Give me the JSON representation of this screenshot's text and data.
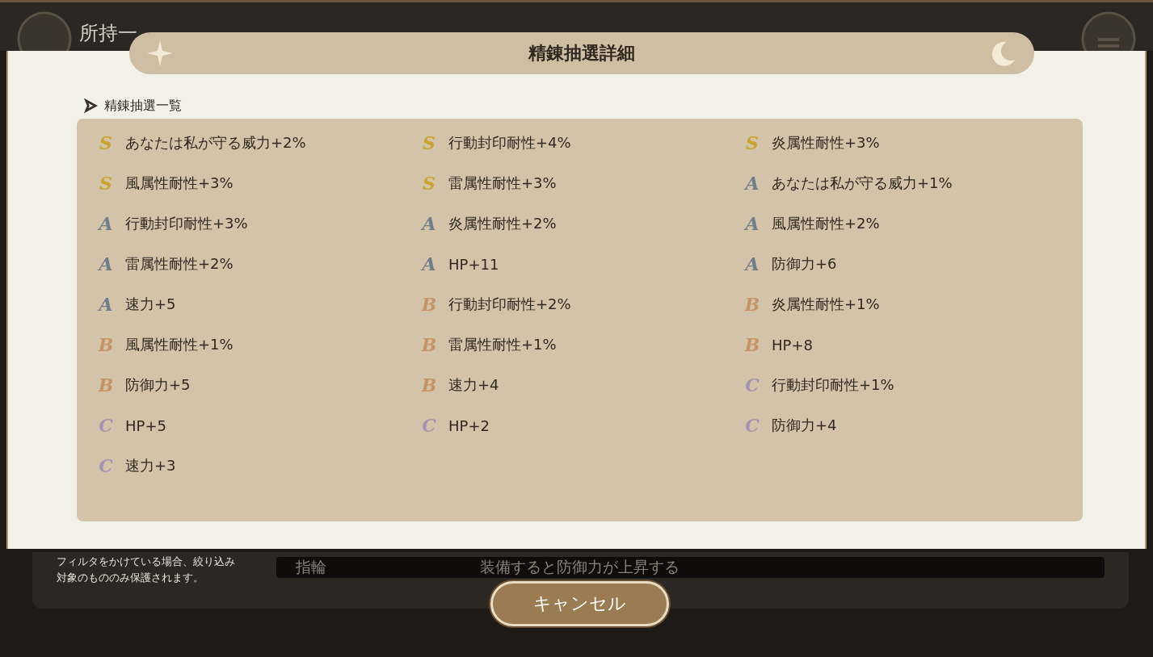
{
  "background": {
    "title": "所持一",
    "help_text": "フィルタをかけている場合、絞り込み対象のもののみ保護されます。",
    "item": {
      "name": "指輪",
      "description": "装備すると防御力が上昇する"
    }
  },
  "dialog": {
    "title": "精錬抽選詳細",
    "section": "精錬抽選一覧",
    "entries": [
      {
        "rank": "S",
        "text": "あなたは私が守る威力+2%"
      },
      {
        "rank": "S",
        "text": "行動封印耐性+4%"
      },
      {
        "rank": "S",
        "text": "炎属性耐性+3%"
      },
      {
        "rank": "S",
        "text": "風属性耐性+3%"
      },
      {
        "rank": "S",
        "text": "雷属性耐性+3%"
      },
      {
        "rank": "A",
        "text": "あなたは私が守る威力+1%"
      },
      {
        "rank": "A",
        "text": "行動封印耐性+3%"
      },
      {
        "rank": "A",
        "text": "炎属性耐性+2%"
      },
      {
        "rank": "A",
        "text": "風属性耐性+2%"
      },
      {
        "rank": "A",
        "text": "雷属性耐性+2%"
      },
      {
        "rank": "A",
        "text": "HP+11"
      },
      {
        "rank": "A",
        "text": "防御力+6"
      },
      {
        "rank": "A",
        "text": "速力+5"
      },
      {
        "rank": "B",
        "text": "行動封印耐性+2%"
      },
      {
        "rank": "B",
        "text": "炎属性耐性+1%"
      },
      {
        "rank": "B",
        "text": "風属性耐性+1%"
      },
      {
        "rank": "B",
        "text": "雷属性耐性+1%"
      },
      {
        "rank": "B",
        "text": "HP+8"
      },
      {
        "rank": "B",
        "text": "防御力+5"
      },
      {
        "rank": "B",
        "text": "速力+4"
      },
      {
        "rank": "C",
        "text": "行動封印耐性+1%"
      },
      {
        "rank": "C",
        "text": "HP+5"
      },
      {
        "rank": "C",
        "text": "HP+2"
      },
      {
        "rank": "C",
        "text": "防御力+4"
      },
      {
        "rank": "C",
        "text": "速力+3"
      }
    ],
    "cancel": "キャンセル"
  }
}
